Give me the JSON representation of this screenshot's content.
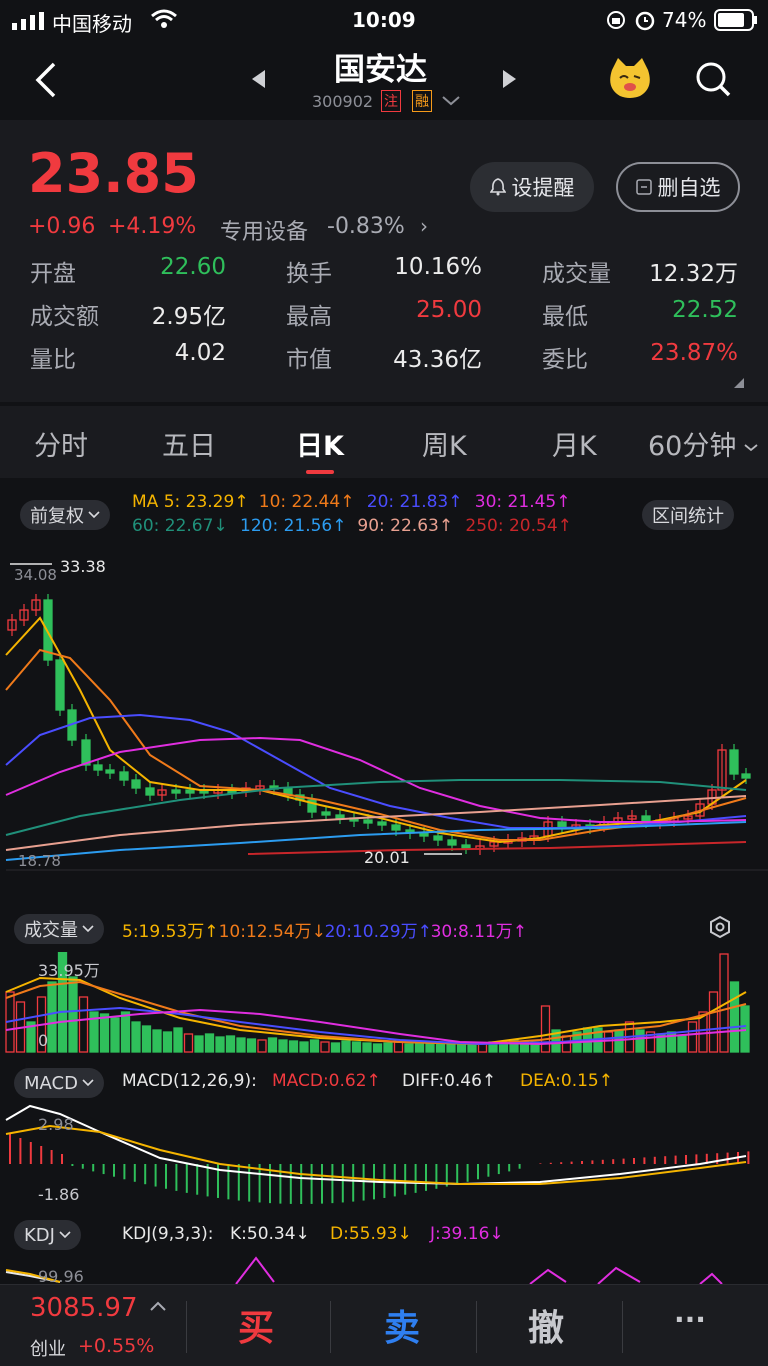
{
  "status": {
    "carrier": "中国移动",
    "time": "10:09",
    "battery": "74%"
  },
  "nav": {
    "title": "国安达",
    "code": "300902",
    "badge1": "注",
    "badge2": "融"
  },
  "quote": {
    "price": "23.85",
    "change": "+0.96",
    "change_pct": "+4.19%",
    "sector": "专用设备",
    "sector_pct": "-0.83%",
    "alert_label": "设提醒",
    "watch_label": "删自选",
    "stats": [
      {
        "label": "开盘",
        "value": "22.60",
        "color": "green"
      },
      {
        "label": "换手",
        "value": "10.16%",
        "color": "white"
      },
      {
        "label": "成交量",
        "value": "12.32万",
        "color": "white"
      },
      {
        "label": "成交额",
        "value": "2.95亿",
        "color": "white"
      },
      {
        "label": "最高",
        "value": "25.00",
        "color": "red"
      },
      {
        "label": "最低",
        "value": "22.52",
        "color": "green"
      },
      {
        "label": "量比",
        "value": "4.02",
        "color": "white"
      },
      {
        "label": "市值",
        "value": "43.36亿",
        "color": "white"
      },
      {
        "label": "委比",
        "value": "23.87%",
        "color": "red"
      }
    ]
  },
  "tabs": [
    "分时",
    "五日",
    "日K",
    "周K",
    "月K",
    "60分钟"
  ],
  "kline": {
    "adjust_label": "前复权",
    "interval_label": "区间统计",
    "ma_row1": [
      {
        "text": "MA 5: 23.29↑",
        "color": "#f5b400"
      },
      {
        "text": "10: 22.44↑",
        "color": "#f07a1a"
      },
      {
        "text": "20: 21.83↑",
        "color": "#4a4dff"
      },
      {
        "text": "30: 21.45↑",
        "color": "#e02ee0"
      }
    ],
    "ma_row2": [
      {
        "text": "60: 22.67↓",
        "color": "#20907a"
      },
      {
        "text": "120: 21.56↑",
        "color": "#2c9cf0"
      },
      {
        "text": "90: 22.63↑",
        "color": "#e8a090"
      },
      {
        "text": "250: 20.54↑",
        "color": "#c8262a"
      }
    ],
    "top_axis": "34.08",
    "bottom_axis": "18.78",
    "max_label": "33.38",
    "min_label": "20.01"
  },
  "volume": {
    "label": "成交量",
    "ma": [
      {
        "text": "5:19.53万↑",
        "color": "#f5b400"
      },
      {
        "text": "10:12.54万↓",
        "color": "#f07a1a"
      },
      {
        "text": "20:10.29万↑",
        "color": "#4a4dff"
      },
      {
        "text": "30:8.11万↑",
        "color": "#e02ee0"
      }
    ],
    "top_axis": "33.95万",
    "zero_axis": "0"
  },
  "macd": {
    "label": "MACD",
    "params": "MACD(12,26,9):",
    "macd": "MACD:0.62↑",
    "diff": "DIFF:0.46↑",
    "dea": "DEA:0.15↑",
    "top_axis": "2.98",
    "bottom_axis": "-1.86"
  },
  "kdj": {
    "label": "KDJ",
    "params": "KDJ(9,3,3):",
    "k": "K:50.34↓",
    "d": "D:55.93↓",
    "j": "J:39.16↓",
    "top_axis": "99.96"
  },
  "footer": {
    "index_value": "3085.97",
    "index_name": "创业",
    "index_pct": "+0.55%",
    "buy": "买",
    "sell": "卖",
    "cancel": "撤",
    "more": "···"
  }
}
